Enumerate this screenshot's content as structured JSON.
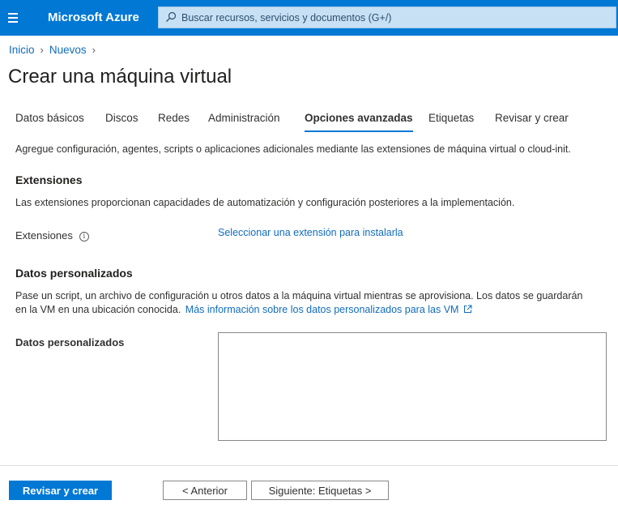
{
  "header": {
    "brand": "Microsoft Azure",
    "search_placeholder": "Buscar recursos, servicios y documentos (G+/)"
  },
  "breadcrumb": {
    "items": [
      "Inicio",
      "Nuevos"
    ]
  },
  "page": {
    "title": "Crear una máquina virtual"
  },
  "tabs": [
    {
      "label": "Datos básicos",
      "active": false
    },
    {
      "label": "Discos",
      "active": false
    },
    {
      "label": "Redes",
      "active": false
    },
    {
      "label": "Administración",
      "active": false
    },
    {
      "label": "Opciones avanzadas",
      "active": true
    },
    {
      "label": "Etiquetas",
      "active": false
    },
    {
      "label": "Revisar y crear",
      "active": false
    }
  ],
  "intro": "Agregue configuración, agentes, scripts o aplicaciones adicionales mediante las extensiones de máquina virtual o cloud-init.",
  "extensions": {
    "heading": "Extensiones",
    "description": "Las extensiones proporcionan capacidades de automatización y configuración posteriores a la implementación.",
    "field_label": "Extensiones",
    "select_link": "Seleccionar una extensión para instalarla"
  },
  "custom_data": {
    "heading": "Datos personalizados",
    "description_line1": "Pase un script, un archivo de configuración u otros datos a la máquina virtual mientras se aprovisiona. Los datos se guardarán",
    "description_line2": "en la VM en una ubicación conocida.",
    "learn_more": "Más información sobre los datos personalizados para las VM",
    "field_label": "Datos personalizados",
    "value": ""
  },
  "footer": {
    "review_create": "Revisar y crear",
    "previous": "< Anterior",
    "next": "Siguiente: Etiquetas >"
  },
  "colors": {
    "accent": "#0078d4",
    "link": "#0f6cbd",
    "search_bg": "#c7e0f4"
  }
}
